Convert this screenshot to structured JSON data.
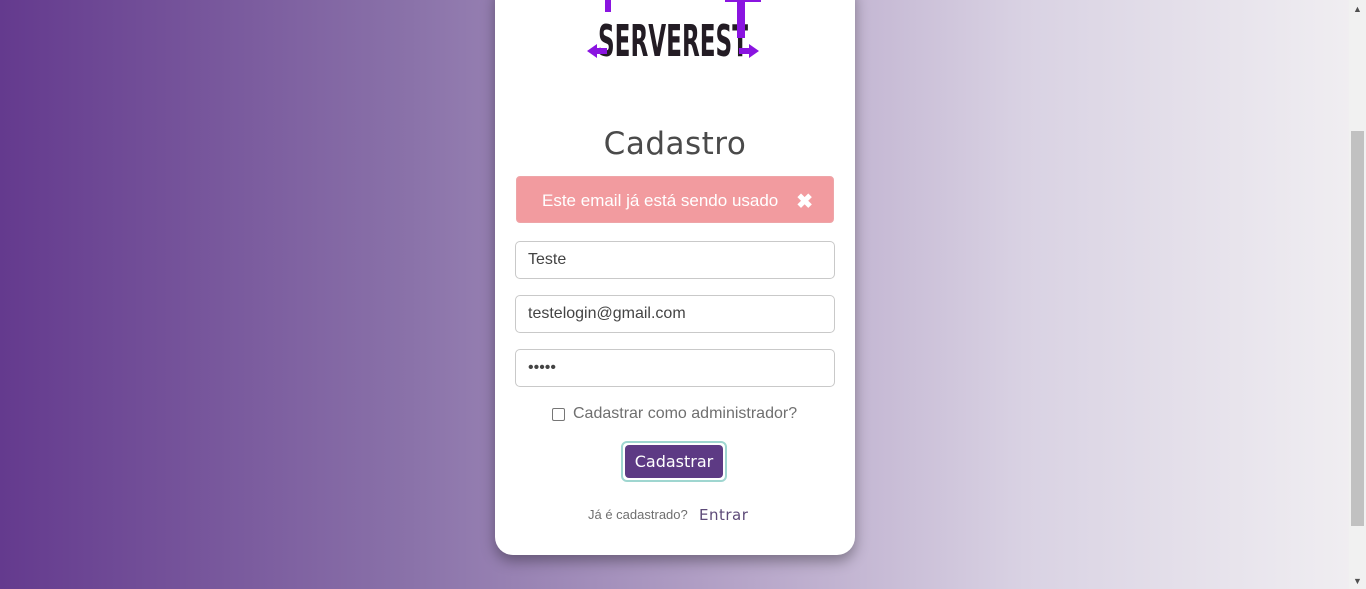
{
  "logo": {
    "text": "SERVEREST"
  },
  "form": {
    "title": "Cadastro",
    "alert": {
      "message": "Este email já está sendo usado",
      "close_symbol": "✖"
    },
    "name_value": "Teste",
    "email_value": "testelogin@gmail.com",
    "password_value": "12345",
    "admin_checkbox_label": "Cadastrar como administrador?",
    "admin_checked": false,
    "submit_label": "Cadastrar",
    "footer_question": "Já é cadastrado?",
    "footer_link": "Entrar"
  },
  "colors": {
    "brand_purple": "#5d3a84",
    "logo_accent": "#8a14e0",
    "alert_bg": "#f29b9f"
  }
}
